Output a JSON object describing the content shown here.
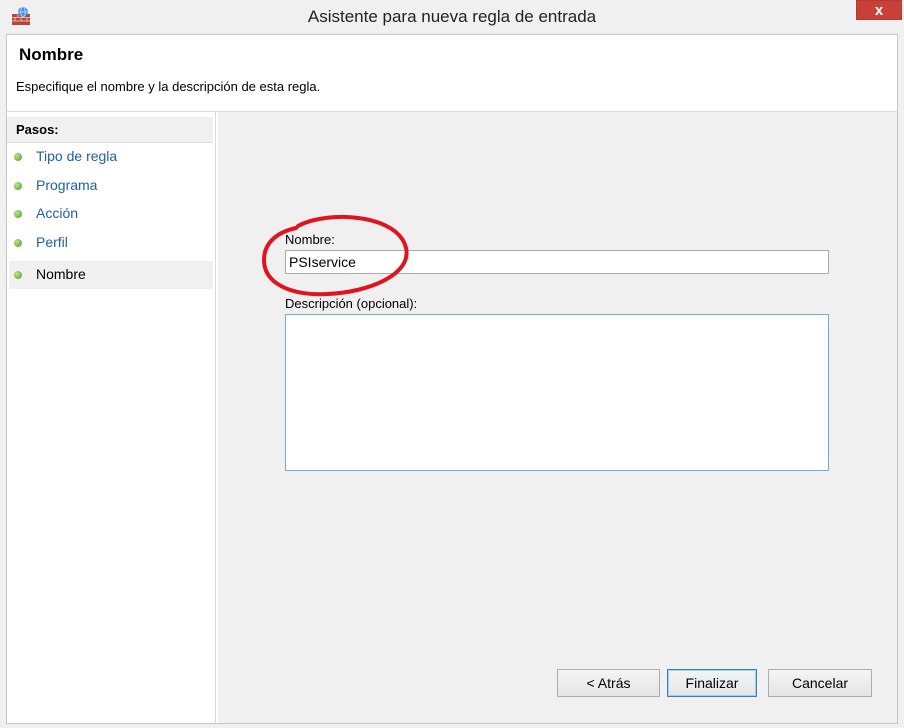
{
  "window": {
    "title": "Asistente para nueva regla de entrada",
    "close_glyph": "x"
  },
  "header": {
    "title": "Nombre",
    "description": "Especifique el nombre y la descripción de esta regla."
  },
  "sidebar": {
    "title": "Pasos:",
    "steps": [
      {
        "label": "Tipo de regla",
        "active": false
      },
      {
        "label": "Programa",
        "active": false
      },
      {
        "label": "Acción",
        "active": false
      },
      {
        "label": "Perfil",
        "active": false
      },
      {
        "label": "Nombre",
        "active": true
      }
    ]
  },
  "form": {
    "name_label": "Nombre:",
    "name_value": "PSIservice",
    "description_label": "Descripción (opcional):",
    "description_value": ""
  },
  "buttons": {
    "back": "< Atrás",
    "finish": "Finalizar",
    "cancel": "Cancelar"
  },
  "colors": {
    "close_button": "#c7413a",
    "link_blue": "#1f5fa6",
    "annotation_red": "#e0141e",
    "step_dot_green": "#4c9a23"
  },
  "icons": {
    "app": "firewall-brick-icon",
    "step": "green-dot-icon"
  }
}
